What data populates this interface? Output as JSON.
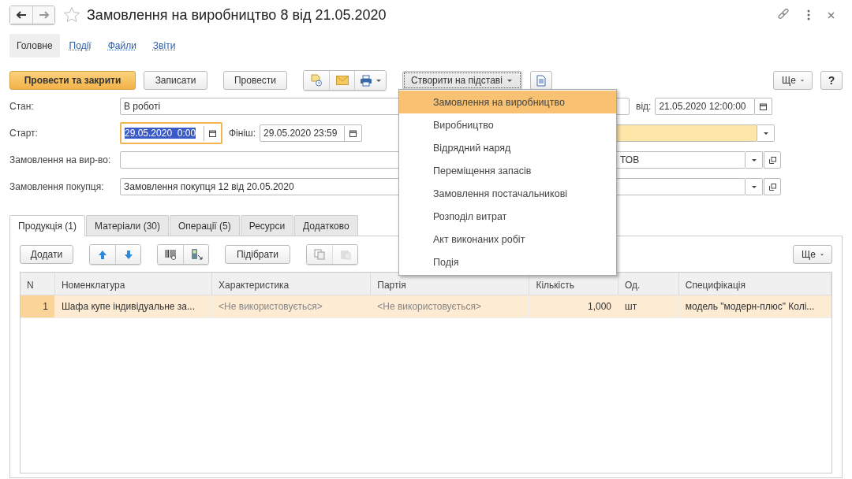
{
  "window": {
    "title": "Замовлення на виробництво 8 від 21.05.2020"
  },
  "sections": [
    {
      "label": "Головне",
      "selected": true
    },
    {
      "label": "Події",
      "selected": false
    },
    {
      "label": "Файли",
      "selected": false
    },
    {
      "label": "Звіти",
      "selected": false
    }
  ],
  "toolbar": {
    "post_close": "Провести та закрити",
    "save": "Записати",
    "post": "Провести",
    "create_based_on": "Створити на підставі",
    "more": "Ще",
    "help": "?"
  },
  "create_menu": {
    "items": [
      {
        "label": "Замовлення на виробництво",
        "selected": true
      },
      {
        "label": "Виробництво",
        "selected": false
      },
      {
        "label": "Відрядний наряд",
        "selected": false
      },
      {
        "label": "Переміщення запасів",
        "selected": false
      },
      {
        "label": "Замовлення постачальникові",
        "selected": false
      },
      {
        "label": "Розподіл витрат",
        "selected": false
      },
      {
        "label": "Акт виконаних робіт",
        "selected": false
      },
      {
        "label": "Подія",
        "selected": false
      }
    ]
  },
  "form": {
    "state": {
      "label": "Стан:",
      "value": "В роботі"
    },
    "start": {
      "label": "Старт:",
      "value": "29.05.2020  0:00",
      "focused": true
    },
    "finish": {
      "label": "Фініш:",
      "value": "29.05.2020 23:59"
    },
    "date": {
      "label": "від:",
      "value": "21.05.2020 12:00:00"
    },
    "production_order": {
      "label": "Замовлення на вир-во:"
    },
    "organization": {
      "value": "ТОВ"
    },
    "customer_order": {
      "label": "Замовлення покупця:",
      "value": "Замовлення покупця 12 від 20.05.2020"
    }
  },
  "tabs": [
    {
      "label": "Продукція (1)",
      "selected": true
    },
    {
      "label": "Матеріали (30)",
      "selected": false
    },
    {
      "label": "Операції (5)",
      "selected": false
    },
    {
      "label": "Ресурси",
      "selected": false
    },
    {
      "label": "Додатково",
      "selected": false
    }
  ],
  "table_toolbar": {
    "add": "Додати",
    "pick": "Підібрати",
    "more": "Ще"
  },
  "table": {
    "columns": [
      "N",
      "Номенклатура",
      "Характеристика",
      "Партія",
      "Кількість",
      "Од.",
      "Специфікація"
    ],
    "rows": [
      {
        "selected": true,
        "cells": [
          "1",
          "Шафа купе індивідуальне за...",
          "<Не використовується>",
          "<Не використовується>",
          "1,000",
          "шт",
          "модель \"модерн-плюс\" Колі..."
        ]
      }
    ]
  }
}
